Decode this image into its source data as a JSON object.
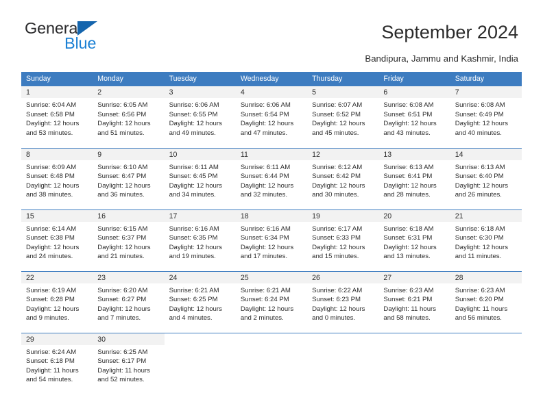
{
  "brand": {
    "name_top": "General",
    "name_bottom": "Blue",
    "triangle_color": "#1565ad",
    "blue_color": "#1b80d4"
  },
  "header": {
    "title": "September 2024",
    "subtitle": "Bandipura, Jammu and Kashmir, India"
  },
  "theme": {
    "accent": "#3d7cc0",
    "daynum_band": "#f2f2f2",
    "text": "#2b2b2b"
  },
  "calendar": {
    "weekdays": [
      "Sunday",
      "Monday",
      "Tuesday",
      "Wednesday",
      "Thursday",
      "Friday",
      "Saturday"
    ],
    "weeks": [
      [
        {
          "day": "1",
          "sunrise": "Sunrise: 6:04 AM",
          "sunset": "Sunset: 6:58 PM",
          "daylight1": "Daylight: 12 hours",
          "daylight2": "and 53 minutes."
        },
        {
          "day": "2",
          "sunrise": "Sunrise: 6:05 AM",
          "sunset": "Sunset: 6:56 PM",
          "daylight1": "Daylight: 12 hours",
          "daylight2": "and 51 minutes."
        },
        {
          "day": "3",
          "sunrise": "Sunrise: 6:06 AM",
          "sunset": "Sunset: 6:55 PM",
          "daylight1": "Daylight: 12 hours",
          "daylight2": "and 49 minutes."
        },
        {
          "day": "4",
          "sunrise": "Sunrise: 6:06 AM",
          "sunset": "Sunset: 6:54 PM",
          "daylight1": "Daylight: 12 hours",
          "daylight2": "and 47 minutes."
        },
        {
          "day": "5",
          "sunrise": "Sunrise: 6:07 AM",
          "sunset": "Sunset: 6:52 PM",
          "daylight1": "Daylight: 12 hours",
          "daylight2": "and 45 minutes."
        },
        {
          "day": "6",
          "sunrise": "Sunrise: 6:08 AM",
          "sunset": "Sunset: 6:51 PM",
          "daylight1": "Daylight: 12 hours",
          "daylight2": "and 43 minutes."
        },
        {
          "day": "7",
          "sunrise": "Sunrise: 6:08 AM",
          "sunset": "Sunset: 6:49 PM",
          "daylight1": "Daylight: 12 hours",
          "daylight2": "and 40 minutes."
        }
      ],
      [
        {
          "day": "8",
          "sunrise": "Sunrise: 6:09 AM",
          "sunset": "Sunset: 6:48 PM",
          "daylight1": "Daylight: 12 hours",
          "daylight2": "and 38 minutes."
        },
        {
          "day": "9",
          "sunrise": "Sunrise: 6:10 AM",
          "sunset": "Sunset: 6:47 PM",
          "daylight1": "Daylight: 12 hours",
          "daylight2": "and 36 minutes."
        },
        {
          "day": "10",
          "sunrise": "Sunrise: 6:11 AM",
          "sunset": "Sunset: 6:45 PM",
          "daylight1": "Daylight: 12 hours",
          "daylight2": "and 34 minutes."
        },
        {
          "day": "11",
          "sunrise": "Sunrise: 6:11 AM",
          "sunset": "Sunset: 6:44 PM",
          "daylight1": "Daylight: 12 hours",
          "daylight2": "and 32 minutes."
        },
        {
          "day": "12",
          "sunrise": "Sunrise: 6:12 AM",
          "sunset": "Sunset: 6:42 PM",
          "daylight1": "Daylight: 12 hours",
          "daylight2": "and 30 minutes."
        },
        {
          "day": "13",
          "sunrise": "Sunrise: 6:13 AM",
          "sunset": "Sunset: 6:41 PM",
          "daylight1": "Daylight: 12 hours",
          "daylight2": "and 28 minutes."
        },
        {
          "day": "14",
          "sunrise": "Sunrise: 6:13 AM",
          "sunset": "Sunset: 6:40 PM",
          "daylight1": "Daylight: 12 hours",
          "daylight2": "and 26 minutes."
        }
      ],
      [
        {
          "day": "15",
          "sunrise": "Sunrise: 6:14 AM",
          "sunset": "Sunset: 6:38 PM",
          "daylight1": "Daylight: 12 hours",
          "daylight2": "and 24 minutes."
        },
        {
          "day": "16",
          "sunrise": "Sunrise: 6:15 AM",
          "sunset": "Sunset: 6:37 PM",
          "daylight1": "Daylight: 12 hours",
          "daylight2": "and 21 minutes."
        },
        {
          "day": "17",
          "sunrise": "Sunrise: 6:16 AM",
          "sunset": "Sunset: 6:35 PM",
          "daylight1": "Daylight: 12 hours",
          "daylight2": "and 19 minutes."
        },
        {
          "day": "18",
          "sunrise": "Sunrise: 6:16 AM",
          "sunset": "Sunset: 6:34 PM",
          "daylight1": "Daylight: 12 hours",
          "daylight2": "and 17 minutes."
        },
        {
          "day": "19",
          "sunrise": "Sunrise: 6:17 AM",
          "sunset": "Sunset: 6:33 PM",
          "daylight1": "Daylight: 12 hours",
          "daylight2": "and 15 minutes."
        },
        {
          "day": "20",
          "sunrise": "Sunrise: 6:18 AM",
          "sunset": "Sunset: 6:31 PM",
          "daylight1": "Daylight: 12 hours",
          "daylight2": "and 13 minutes."
        },
        {
          "day": "21",
          "sunrise": "Sunrise: 6:18 AM",
          "sunset": "Sunset: 6:30 PM",
          "daylight1": "Daylight: 12 hours",
          "daylight2": "and 11 minutes."
        }
      ],
      [
        {
          "day": "22",
          "sunrise": "Sunrise: 6:19 AM",
          "sunset": "Sunset: 6:28 PM",
          "daylight1": "Daylight: 12 hours",
          "daylight2": "and 9 minutes."
        },
        {
          "day": "23",
          "sunrise": "Sunrise: 6:20 AM",
          "sunset": "Sunset: 6:27 PM",
          "daylight1": "Daylight: 12 hours",
          "daylight2": "and 7 minutes."
        },
        {
          "day": "24",
          "sunrise": "Sunrise: 6:21 AM",
          "sunset": "Sunset: 6:25 PM",
          "daylight1": "Daylight: 12 hours",
          "daylight2": "and 4 minutes."
        },
        {
          "day": "25",
          "sunrise": "Sunrise: 6:21 AM",
          "sunset": "Sunset: 6:24 PM",
          "daylight1": "Daylight: 12 hours",
          "daylight2": "and 2 minutes."
        },
        {
          "day": "26",
          "sunrise": "Sunrise: 6:22 AM",
          "sunset": "Sunset: 6:23 PM",
          "daylight1": "Daylight: 12 hours",
          "daylight2": "and 0 minutes."
        },
        {
          "day": "27",
          "sunrise": "Sunrise: 6:23 AM",
          "sunset": "Sunset: 6:21 PM",
          "daylight1": "Daylight: 11 hours",
          "daylight2": "and 58 minutes."
        },
        {
          "day": "28",
          "sunrise": "Sunrise: 6:23 AM",
          "sunset": "Sunset: 6:20 PM",
          "daylight1": "Daylight: 11 hours",
          "daylight2": "and 56 minutes."
        }
      ],
      [
        {
          "day": "29",
          "sunrise": "Sunrise: 6:24 AM",
          "sunset": "Sunset: 6:18 PM",
          "daylight1": "Daylight: 11 hours",
          "daylight2": "and 54 minutes."
        },
        {
          "day": "30",
          "sunrise": "Sunrise: 6:25 AM",
          "sunset": "Sunset: 6:17 PM",
          "daylight1": "Daylight: 11 hours",
          "daylight2": "and 52 minutes."
        },
        {
          "day": "",
          "sunrise": "",
          "sunset": "",
          "daylight1": "",
          "daylight2": ""
        },
        {
          "day": "",
          "sunrise": "",
          "sunset": "",
          "daylight1": "",
          "daylight2": ""
        },
        {
          "day": "",
          "sunrise": "",
          "sunset": "",
          "daylight1": "",
          "daylight2": ""
        },
        {
          "day": "",
          "sunrise": "",
          "sunset": "",
          "daylight1": "",
          "daylight2": ""
        },
        {
          "day": "",
          "sunrise": "",
          "sunset": "",
          "daylight1": "",
          "daylight2": ""
        }
      ]
    ]
  }
}
